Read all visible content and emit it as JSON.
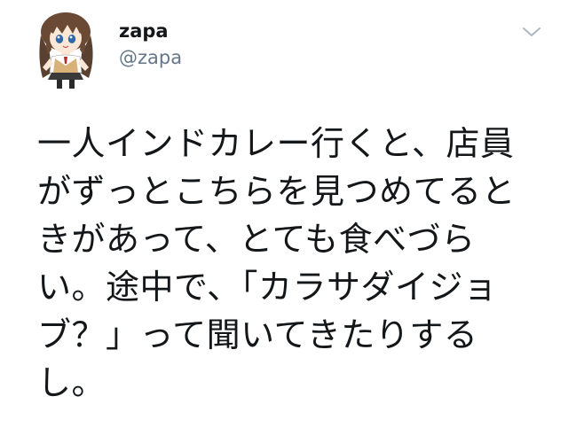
{
  "author": {
    "display_name": "zapa",
    "handle": "@zapa",
    "avatar_icon": "anime-girl-avatar-icon"
  },
  "menu": {
    "icon": "chevron-down-icon"
  },
  "tweet": {
    "lines": [
      "一人インドカレー行くと、店員",
      "がずっとこちらを見つめてると",
      "きがあって、とても食べづら",
      "い。途中で、「カラサダイジョ",
      "ブ？」って聞いてきたりする",
      "し。"
    ]
  },
  "colors": {
    "text": "#14171a",
    "secondary": "#657786",
    "chevron": "#aab8c2"
  }
}
